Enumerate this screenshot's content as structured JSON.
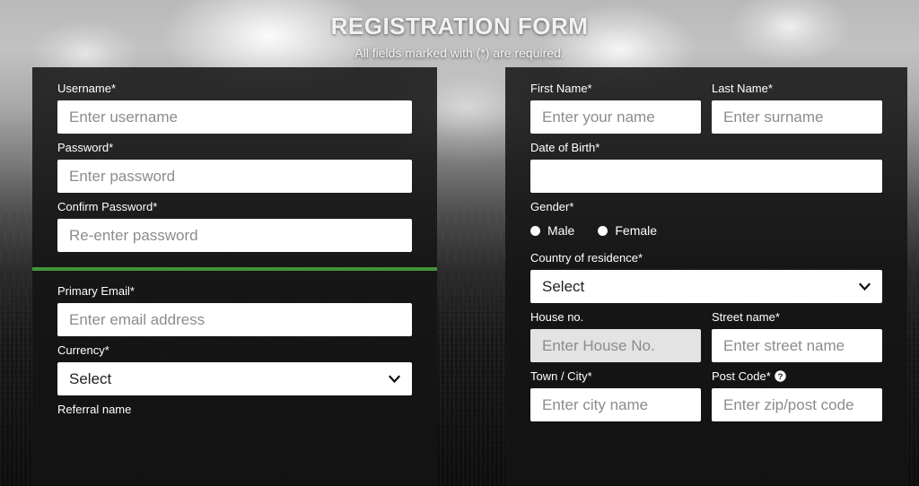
{
  "header": {
    "title": "REGISTRATION FORM",
    "subtitle": "All fields marked with (*) are required."
  },
  "colors": {
    "divider_green": "#4a9e3f",
    "input_background": "#ffffff",
    "input_disabled_background": "#e3e3e3",
    "card_background": "rgba(20,20,20,0.86)",
    "placeholder_text": "#8c8c8c",
    "label_text": "#ffffff"
  },
  "left_column": {
    "username": {
      "label": "Username*",
      "placeholder": "Enter username",
      "value": ""
    },
    "password": {
      "label": "Password*",
      "placeholder": "Enter password",
      "value": ""
    },
    "confirm_password": {
      "label": "Confirm Password*",
      "placeholder": "Re-enter password",
      "value": ""
    },
    "primary_email": {
      "label": "Primary Email*",
      "placeholder": "Enter email address",
      "value": ""
    },
    "currency": {
      "label": "Currency*",
      "selected": "Select",
      "chevron_icon": "chevron-down-icon"
    },
    "referral_name": {
      "label": "Referral name"
    }
  },
  "right_column": {
    "first_name": {
      "label": "First Name*",
      "placeholder": "Enter your name",
      "value": ""
    },
    "last_name": {
      "label": "Last Name*",
      "placeholder": "Enter surname",
      "value": ""
    },
    "date_of_birth": {
      "label": "Date of Birth*",
      "placeholder": "",
      "value": ""
    },
    "gender": {
      "label": "Gender*",
      "options": [
        {
          "label": "Male",
          "selected": false
        },
        {
          "label": "Female",
          "selected": false
        }
      ]
    },
    "country_of_residence": {
      "label": "Country of residence*",
      "selected": "Select",
      "chevron_icon": "chevron-down-icon"
    },
    "house_no": {
      "label": "House no.",
      "placeholder": "Enter House No.",
      "value": "",
      "disabled": true
    },
    "street_name": {
      "label": "Street name*",
      "placeholder": "Enter street name",
      "value": ""
    },
    "town_city": {
      "label": "Town / City*",
      "placeholder": "Enter city name",
      "value": ""
    },
    "post_code": {
      "label": "Post Code*",
      "placeholder": "Enter zip/post code",
      "value": "",
      "help_icon": "help-question-icon"
    }
  }
}
